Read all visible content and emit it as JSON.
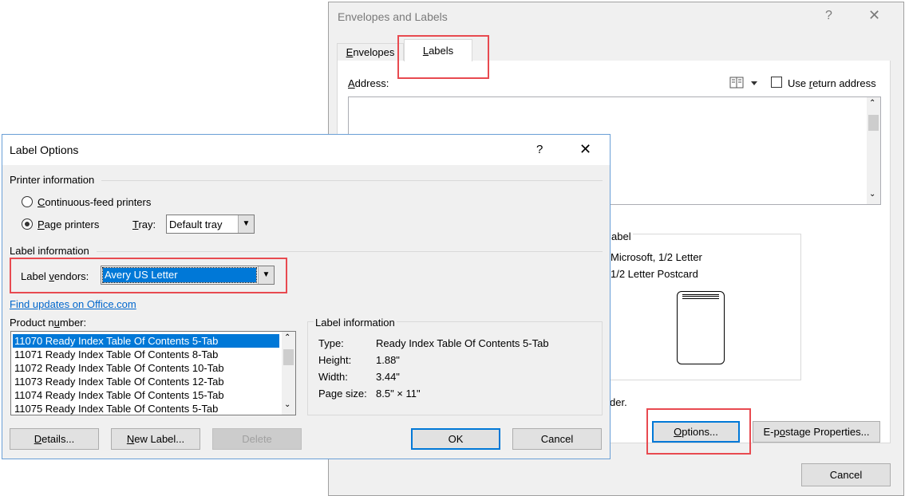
{
  "envelopes_dialog": {
    "title": "Envelopes and Labels",
    "help": "?",
    "close": "✕",
    "tabs": [
      {
        "label_pre": "",
        "label_u": "E",
        "label_post": "nvelopes",
        "active": false
      },
      {
        "label_pre": "",
        "label_u": "L",
        "label_post": "abels",
        "active": true
      }
    ],
    "address_pre": "",
    "address_u": "A",
    "address_post": "ddress:",
    "use_return_pre": "Use ",
    "use_return_u": "r",
    "use_return_post": "eturn address",
    "address_value": "",
    "label_section_title": "abel",
    "label_line1": "Microsoft, 1/2 Letter",
    "label_line2": "1/2 Letter Postcard",
    "print_text": "der.",
    "options_pre": "",
    "options_u": "O",
    "options_post": "ptions...",
    "epostage_pre": "E-p",
    "epostage_u": "o",
    "epostage_post": "stage Properties...",
    "cancel": "Cancel"
  },
  "label_options": {
    "title": "Label Options",
    "help": "?",
    "close": "✕",
    "printer_info_title": "Printer information",
    "continuous_pre": "",
    "continuous_u": "C",
    "continuous_post": "ontinuous-feed printers",
    "page_pre": "",
    "page_u": "P",
    "page_post": "age printers",
    "tray_pre": "",
    "tray_u": "T",
    "tray_post": "ray:",
    "tray_value": "Default tray",
    "label_info_title": "Label information",
    "vendors_pre": "Label ",
    "vendors_u": "v",
    "vendors_post": "endors:",
    "vendors_value": "Avery US Letter",
    "find_updates": "Find updates on Office.com",
    "product_pre": "Product n",
    "product_u": "u",
    "product_post": "mber:",
    "products": [
      "11070 Ready Index Table Of Contents 5-Tab",
      "11071 Ready Index Table Of Contents 8-Tab",
      "11072 Ready Index Table Of Contents 10-Tab",
      "11073 Ready Index Table Of Contents 12-Tab",
      "11074 Ready Index Table Of Contents 15-Tab",
      "11075 Ready Index Table Of Contents 5-Tab"
    ],
    "info_box_title": "Label information",
    "info": {
      "type_label": "Type:",
      "type_value": "Ready Index Table Of Contents 5-Tab",
      "height_label": "Height:",
      "height_value": "1.88\"",
      "width_label": "Width:",
      "width_value": "3.44\"",
      "pagesize_label": "Page size:",
      "pagesize_value": "8.5\" × 11\""
    },
    "details_pre": "",
    "details_u": "D",
    "details_post": "etails...",
    "newlabel_pre": "",
    "newlabel_u": "N",
    "newlabel_post": "ew Label...",
    "delete": "Delete",
    "ok": "OK",
    "cancel": "Cancel"
  },
  "highlight_color": "#e84a50",
  "selection_color": "#0078d7"
}
